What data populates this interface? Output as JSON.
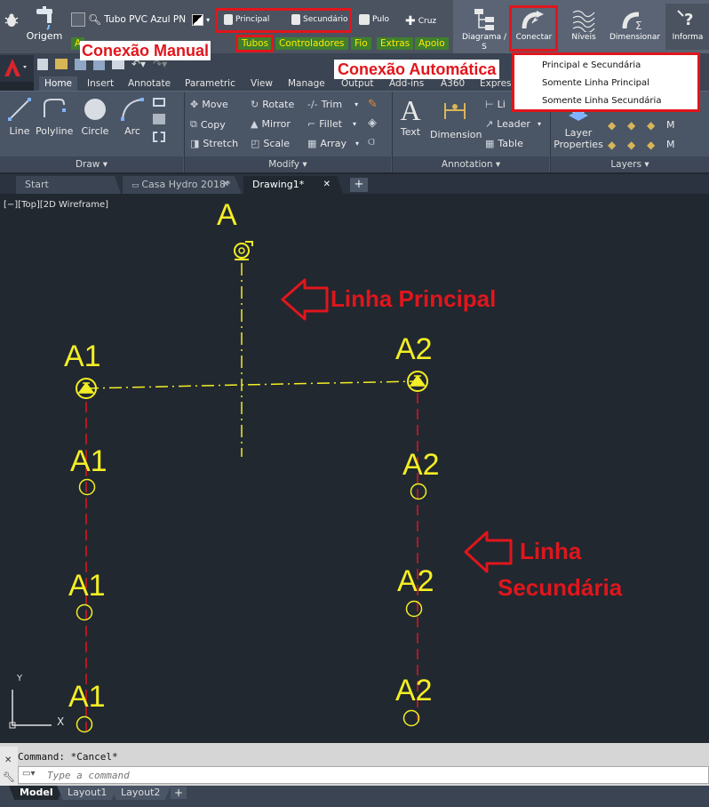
{
  "hydro_toolbar": {
    "origem_label": "Origem",
    "pipe_type": "Tubo PVC Azul PN",
    "principal_label": "Principal",
    "secundario_label": "Secundário",
    "pulo_label": "Pulo",
    "cruz_label": "Cruz",
    "diagrama_label": "Diagrama / S",
    "conectar_label": "Conectar",
    "niveis_label": "Níveis",
    "dimensionar_label": "Dimensionar",
    "informa_label": "Informa",
    "tabs": [
      "Tubos",
      "Controladores",
      "Fio",
      "Extras",
      "Apoio"
    ],
    "tab_prefix": "A"
  },
  "annotations": {
    "manual": "Conexão Manual",
    "automatica": "Conexão Automática",
    "linha_principal": "Linha Principal",
    "linha_secundaria_1": "Linha",
    "linha_secundaria_2": "Secundária"
  },
  "dropdown": {
    "items": [
      "Principal e Secundária",
      "Somente Linha Principal",
      "Somente Linha Secundária"
    ]
  },
  "ribbon": {
    "tabs": [
      "Home",
      "Insert",
      "Annotate",
      "Parametric",
      "View",
      "Manage",
      "Output",
      "Add-ins",
      "A360",
      "Expres"
    ],
    "active_tab": "Home",
    "draw": {
      "title": "Draw",
      "line": "Line",
      "polyline": "Polyline",
      "circle": "Circle",
      "arc": "Arc"
    },
    "modify": {
      "title": "Modify",
      "move": "Move",
      "rotate": "Rotate",
      "trim": "Trim",
      "copy": "Copy",
      "mirror": "Mirror",
      "fillet": "Fillet",
      "stretch": "Stretch",
      "scale": "Scale",
      "array": "Array"
    },
    "annotation": {
      "title": "Annotation",
      "text": "Text",
      "dimension": "Dimension",
      "linear": "Li",
      "leader": "Leader",
      "table": "Table"
    },
    "layers": {
      "title": "Layers",
      "layer_properties_1": "Layer",
      "layer_properties_2": "Properties",
      "m": "M"
    }
  },
  "doc_tabs": [
    {
      "label": "Start",
      "active": false
    },
    {
      "label": "Casa Hydro 2018*",
      "active": false
    },
    {
      "label": "Drawing1*",
      "active": true
    }
  ],
  "drawing": {
    "viewport_label": "[−][Top][2D Wireframe]",
    "labels": {
      "a": "A",
      "a1": "A1",
      "a2": "A2"
    },
    "ucs": {
      "y": "Y",
      "x": "X"
    }
  },
  "command": {
    "history": "Command: *Cancel*",
    "placeholder": "Type a command"
  },
  "layout_tabs": [
    "Model",
    "Layout1",
    "Layout2"
  ],
  "colors": {
    "annotation_red": "#e0161c",
    "label_yellow": "#f4ee24",
    "secondary_line": "#e0161c",
    "canvas_bg": "#212830"
  }
}
